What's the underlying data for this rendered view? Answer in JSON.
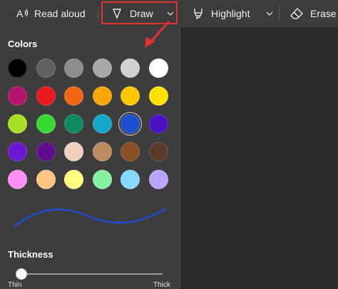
{
  "toolbar": {
    "read_aloud_label": "Read aloud",
    "draw_label": "Draw",
    "highlight_label": "Highlight",
    "erase_label": "Erase",
    "icons": {
      "read_aloud": "read-aloud-icon",
      "draw": "pen-icon",
      "highlight": "highlighter-icon",
      "erase": "eraser-icon",
      "dropdown": "chevron-down-icon"
    }
  },
  "annotation": {
    "highlight_color": "#e0322f"
  },
  "panel": {
    "colors_heading": "Colors",
    "thickness_heading": "Thickness",
    "thin_label": "Thin",
    "thick_label": "Thick",
    "thickness_value": 0.04,
    "selected_color": "#1f4fd1",
    "swatches": [
      [
        "#000000",
        "#5f6061",
        "#8c8c8c",
        "#a8a8a8",
        "#d1d1d1",
        "#ffffff"
      ],
      [
        "#b3136f",
        "#e8191d",
        "#f26512",
        "#f8a607",
        "#fbc700",
        "#ffe200"
      ],
      [
        "#a6e126",
        "#39d934",
        "#0f8a5e",
        "#14a7c8",
        "#1f4fd1",
        "#4b10c2"
      ],
      [
        "#6a17cf",
        "#5e0e8c",
        "#f3d0bd",
        "#bd8b5f",
        "#8a4f25",
        "#5c3a2a"
      ],
      [
        "#ff8ff2",
        "#ffc582",
        "#ffff80",
        "#84f2a0",
        "#86d8ff",
        "#b9a7ff"
      ]
    ]
  }
}
